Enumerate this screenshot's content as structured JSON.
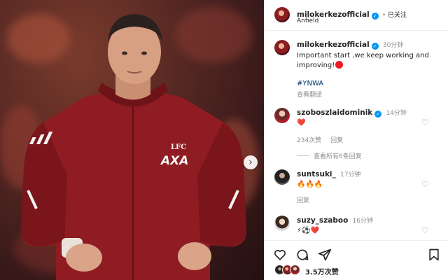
{
  "post": {
    "author": "milokerkezofficial",
    "follow_status": "已关注",
    "location": "Anfield"
  },
  "caption": {
    "author": "milokerkezofficial",
    "time": "30分钟",
    "text": "Important start ,we keep working and improving!",
    "hashtag": "#YNWA",
    "translate": "查看翻译"
  },
  "comments": [
    {
      "user": "szoboszlaidominik",
      "verified": true,
      "time": "14分钟",
      "text": "❤️",
      "likes": "234次赞",
      "reply": "回复",
      "view_replies": "查看所有6条回复"
    },
    {
      "user": "suntsuki_",
      "verified": false,
      "time": "17分钟",
      "text": "🔥🔥🔥",
      "reply": "回复"
    },
    {
      "user": "suzy_szaboo",
      "verified": false,
      "time": "16分钟",
      "text": "⚡⚽❤️"
    }
  ],
  "actions": {
    "like_icon": "heart-outline-icon",
    "comment_icon": "comment-icon",
    "share_icon": "share-icon",
    "save_icon": "bookmark-icon"
  },
  "likes": {
    "count": "3.5万次赞"
  },
  "photo": {
    "jersey_crest": "LFC",
    "jersey_sponsor": "AXA",
    "jersey_color": "#8f1c22"
  },
  "colors": {
    "verified": "#0095f6",
    "link": "#00376b",
    "heart": "#ed4956"
  }
}
